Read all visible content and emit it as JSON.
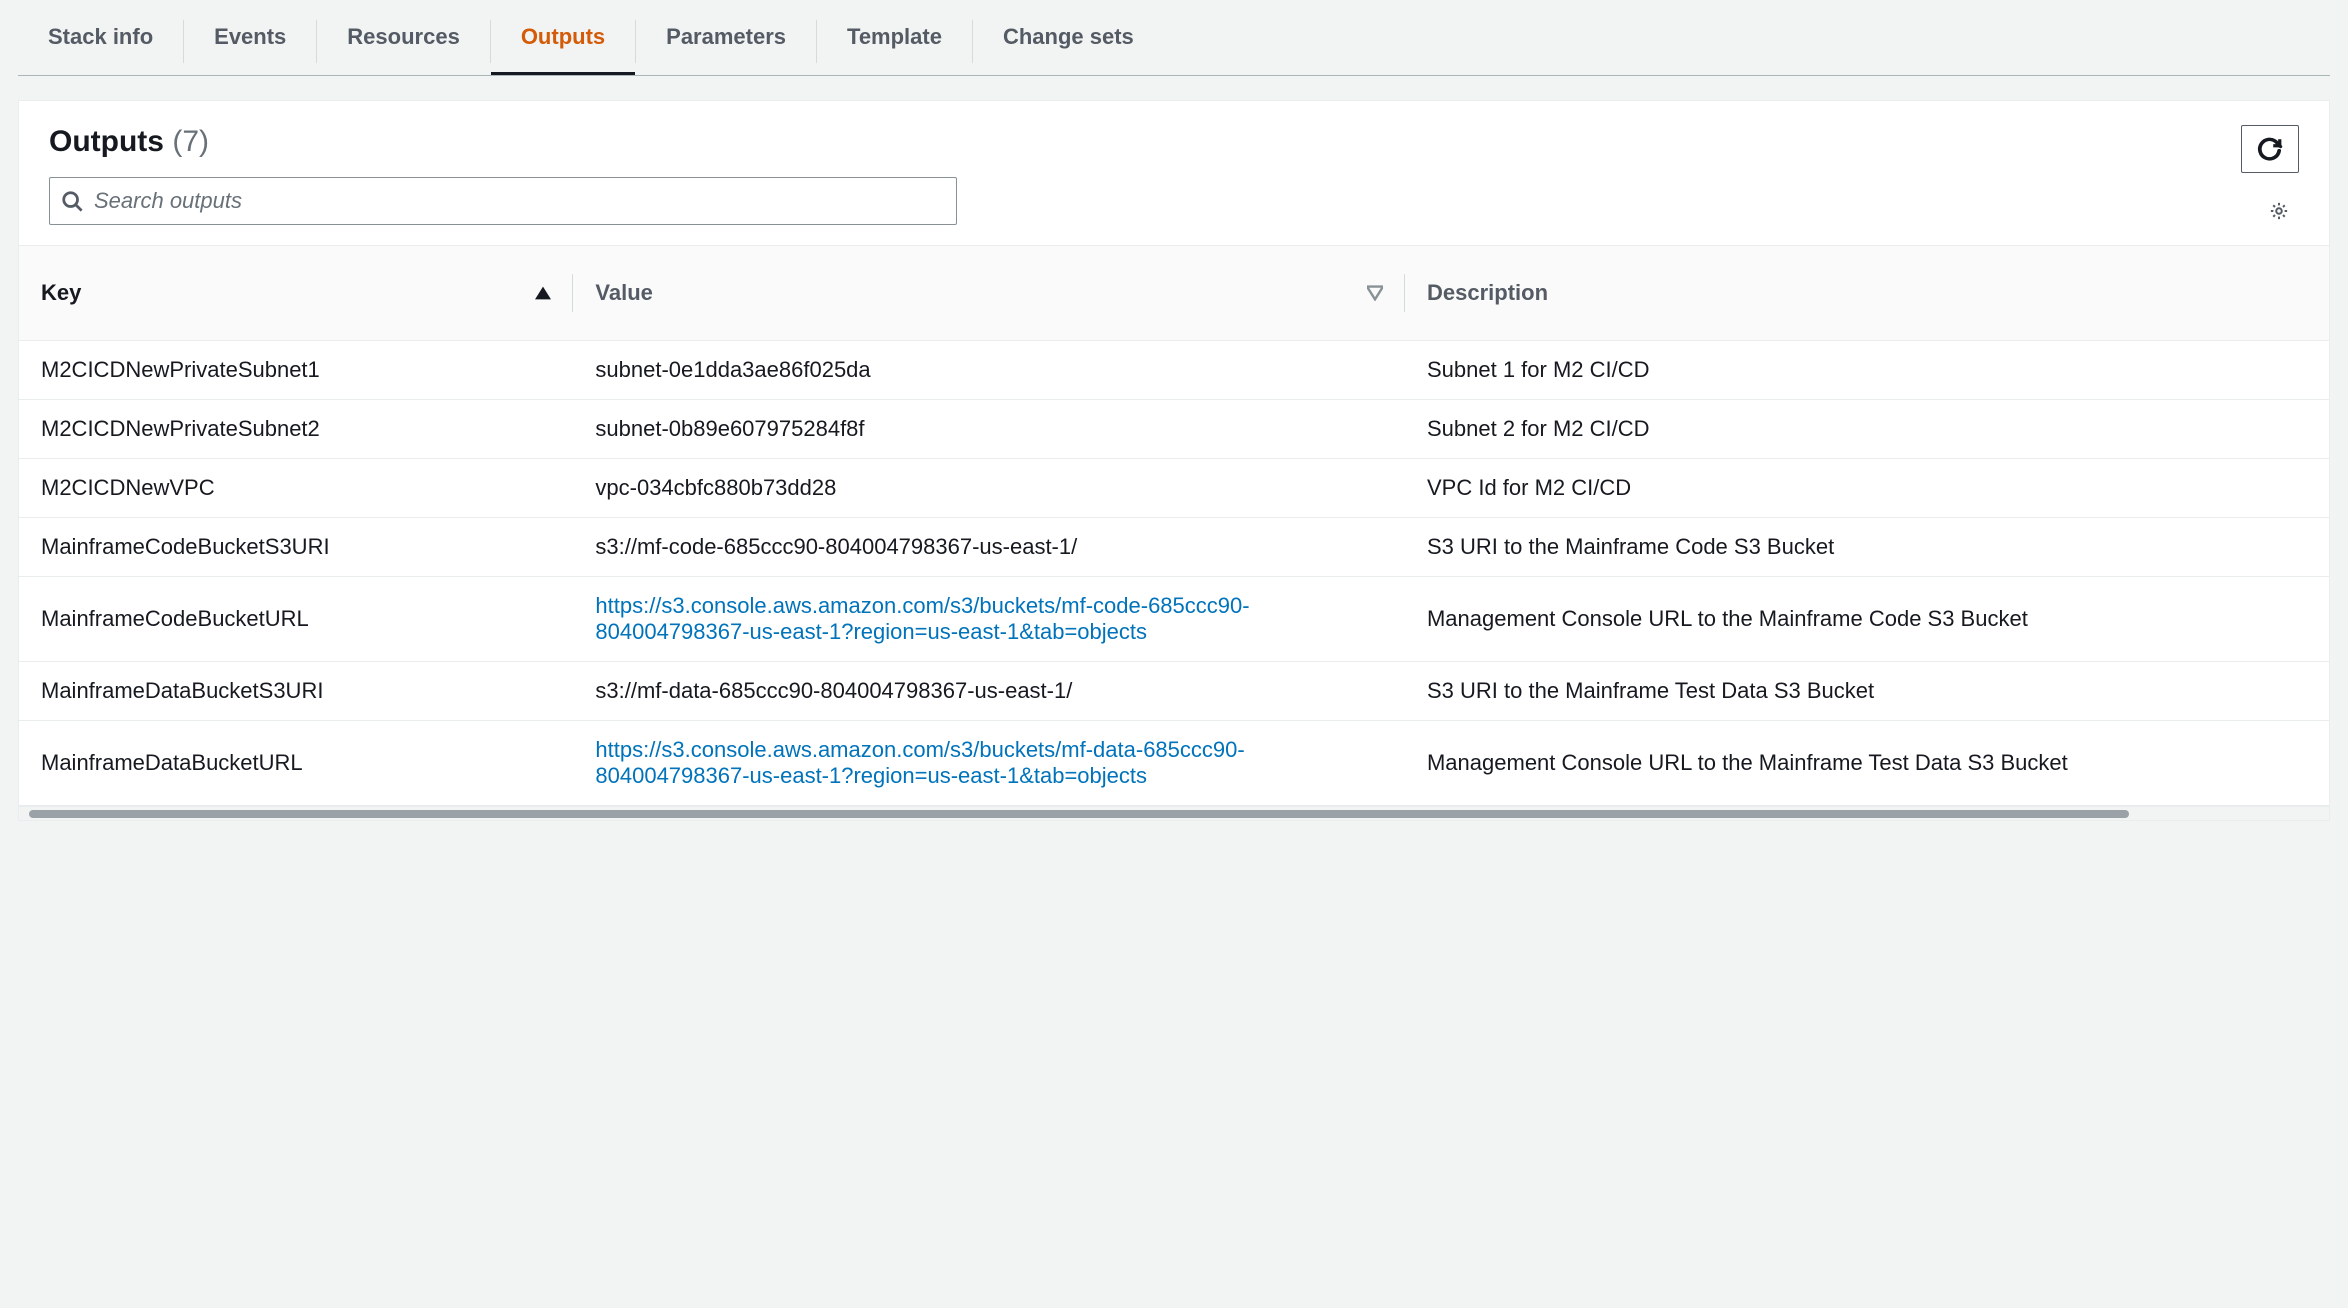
{
  "tabs": [
    {
      "id": "stack-info",
      "label": "Stack info"
    },
    {
      "id": "events",
      "label": "Events"
    },
    {
      "id": "resources",
      "label": "Resources"
    },
    {
      "id": "outputs",
      "label": "Outputs",
      "active": true
    },
    {
      "id": "parameters",
      "label": "Parameters"
    },
    {
      "id": "template",
      "label": "Template"
    },
    {
      "id": "change-sets",
      "label": "Change sets"
    }
  ],
  "panel": {
    "title": "Outputs",
    "count_label": "(7)"
  },
  "search": {
    "placeholder": "Search outputs",
    "value": ""
  },
  "columns": {
    "key": "Key",
    "value": "Value",
    "description": "Description"
  },
  "sort": {
    "column": "key",
    "direction": "asc"
  },
  "rows": [
    {
      "key": "M2CICDNewPrivateSubnet1",
      "value": "subnet-0e1dda3ae86f025da",
      "is_link": false,
      "description": "Subnet 1 for M2 CI/CD"
    },
    {
      "key": "M2CICDNewPrivateSubnet2",
      "value": "subnet-0b89e607975284f8f",
      "is_link": false,
      "description": "Subnet 2 for M2 CI/CD"
    },
    {
      "key": "M2CICDNewVPC",
      "value": "vpc-034cbfc880b73dd28",
      "is_link": false,
      "description": "VPC Id for M2 CI/CD"
    },
    {
      "key": "MainframeCodeBucketS3URI",
      "value": "s3://mf-code-685ccc90-804004798367-us-east-1/",
      "is_link": false,
      "description": "S3 URI to the Mainframe Code S3 Bucket"
    },
    {
      "key": "MainframeCodeBucketURL",
      "value": "https://s3.console.aws.amazon.com/s3/buckets/mf-code-685ccc90-804004798367-us-east-1?region=us-east-1&tab=objects",
      "is_link": true,
      "description": "Management Console URL to the Mainframe Code S3 Bucket"
    },
    {
      "key": "MainframeDataBucketS3URI",
      "value": "s3://mf-data-685ccc90-804004798367-us-east-1/",
      "is_link": false,
      "description": "S3 URI to the Mainframe Test Data S3 Bucket"
    },
    {
      "key": "MainframeDataBucketURL",
      "value": "https://s3.console.aws.amazon.com/s3/buckets/mf-data-685ccc90-804004798367-us-east-1?region=us-east-1&tab=objects",
      "is_link": true,
      "description": "Management Console URL to the Mainframe Test Data S3 Bucket"
    }
  ],
  "icons": {
    "search": "search-icon",
    "refresh": "refresh-icon",
    "gear": "gear-icon",
    "sort_asc": "sort-asc-icon",
    "sort_desc": "sort-unsorted-icon"
  }
}
